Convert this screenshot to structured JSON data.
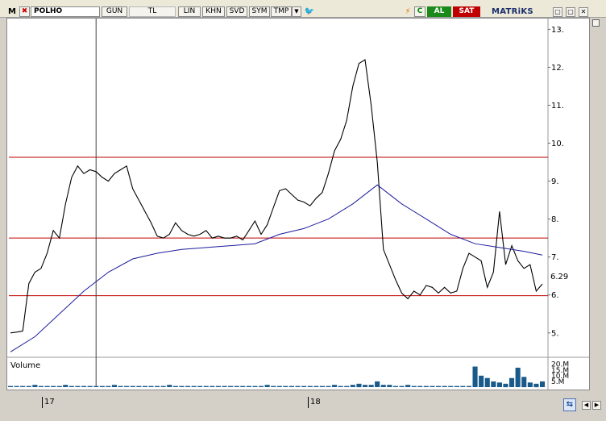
{
  "toolbar": {
    "logo": "M",
    "close": "✖",
    "symbol": "POLHO",
    "buttons": [
      "GUN",
      "TL",
      "LIN",
      "KHN",
      "SVD",
      "SYM",
      "TMP"
    ],
    "dropdown": "▼",
    "twitter": "🐦",
    "bolt": "⚡",
    "refresh": "C",
    "buy_label": "AL",
    "sell_label": "SAT",
    "brand": "MATRiKS",
    "win_controls": [
      "▢",
      "▢",
      "✕"
    ]
  },
  "colors": {
    "price_line": "#000000",
    "ma_line": "#1c1c9c",
    "h_line": "#c00000",
    "cursor_line": "#404040",
    "volume": "#1a5a8a",
    "buy": "#1a8a1a",
    "sell": "#c00000"
  },
  "chart_data": [
    {
      "type": "line",
      "y_ticks": [
        "13.",
        "12.",
        "11.",
        "10.",
        "9.",
        "8.",
        "7.",
        "6.",
        "5."
      ],
      "y_values": [
        13,
        12,
        11,
        10,
        9,
        8,
        7,
        6,
        5
      ],
      "ylim": [
        4.4,
        13.2
      ],
      "last_price_label": "6.29",
      "last_price": 6.29,
      "x_labels": [
        "17",
        "18"
      ],
      "horizontal_levels": [
        9.63,
        7.5,
        5.98
      ],
      "series": [
        {
          "points": [
            [
              0,
              5.0
            ],
            [
              1,
              5.02
            ],
            [
              2,
              5.05
            ],
            [
              3,
              6.3
            ],
            [
              4,
              6.6
            ],
            [
              5,
              6.7
            ],
            [
              6,
              7.1
            ],
            [
              7,
              7.7
            ],
            [
              8,
              7.5
            ],
            [
              9,
              8.4
            ],
            [
              10,
              9.1
            ],
            [
              11,
              9.4
            ],
            [
              12,
              9.2
            ],
            [
              13,
              9.3
            ],
            [
              14,
              9.25
            ],
            [
              15,
              9.1
            ],
            [
              16,
              9.0
            ],
            [
              17,
              9.2
            ],
            [
              18,
              9.3
            ],
            [
              19,
              9.4
            ],
            [
              20,
              8.8
            ],
            [
              21,
              8.5
            ],
            [
              22,
              8.2
            ],
            [
              23,
              7.9
            ],
            [
              24,
              7.55
            ],
            [
              25,
              7.5
            ],
            [
              26,
              7.6
            ],
            [
              27,
              7.9
            ],
            [
              28,
              7.7
            ],
            [
              29,
              7.6
            ],
            [
              30,
              7.55
            ],
            [
              31,
              7.6
            ],
            [
              32,
              7.7
            ],
            [
              33,
              7.5
            ],
            [
              34,
              7.55
            ],
            [
              35,
              7.5
            ],
            [
              36,
              7.5
            ],
            [
              37,
              7.55
            ],
            [
              38,
              7.45
            ],
            [
              39,
              7.7
            ],
            [
              40,
              7.95
            ],
            [
              41,
              7.6
            ],
            [
              42,
              7.85
            ],
            [
              43,
              8.3
            ],
            [
              44,
              8.75
            ],
            [
              45,
              8.8
            ],
            [
              46,
              8.65
            ],
            [
              47,
              8.5
            ],
            [
              48,
              8.45
            ],
            [
              49,
              8.35
            ],
            [
              50,
              8.55
            ],
            [
              51,
              8.7
            ],
            [
              52,
              9.2
            ],
            [
              53,
              9.8
            ],
            [
              54,
              10.1
            ],
            [
              55,
              10.6
            ],
            [
              56,
              11.5
            ],
            [
              57,
              12.1
            ],
            [
              58,
              12.2
            ],
            [
              59,
              11.0
            ],
            [
              60,
              9.5
            ],
            [
              61,
              7.2
            ],
            [
              62,
              6.8
            ],
            [
              63,
              6.4
            ],
            [
              64,
              6.05
            ],
            [
              65,
              5.9
            ],
            [
              66,
              6.1
            ],
            [
              67,
              6.0
            ],
            [
              68,
              6.25
            ],
            [
              69,
              6.2
            ],
            [
              70,
              6.05
            ],
            [
              71,
              6.2
            ],
            [
              72,
              6.05
            ],
            [
              73,
              6.1
            ],
            [
              74,
              6.7
            ],
            [
              75,
              7.1
            ],
            [
              76,
              7.0
            ],
            [
              77,
              6.9
            ],
            [
              78,
              6.2
            ],
            [
              79,
              6.6
            ],
            [
              80,
              8.2
            ],
            [
              81,
              6.8
            ],
            [
              82,
              7.3
            ],
            [
              83,
              6.9
            ],
            [
              84,
              6.7
            ],
            [
              85,
              6.8
            ],
            [
              86,
              6.1
            ],
            [
              87,
              6.29
            ]
          ]
        },
        {
          "points": [
            [
              0,
              4.5
            ],
            [
              4,
              4.9
            ],
            [
              8,
              5.5
            ],
            [
              12,
              6.1
            ],
            [
              16,
              6.6
            ],
            [
              20,
              6.95
            ],
            [
              24,
              7.1
            ],
            [
              28,
              7.2
            ],
            [
              32,
              7.25
            ],
            [
              36,
              7.3
            ],
            [
              40,
              7.35
            ],
            [
              44,
              7.6
            ],
            [
              48,
              7.75
            ],
            [
              52,
              8.0
            ],
            [
              56,
              8.4
            ],
            [
              60,
              8.9
            ],
            [
              64,
              8.4
            ],
            [
              68,
              8.0
            ],
            [
              72,
              7.6
            ],
            [
              76,
              7.35
            ],
            [
              80,
              7.25
            ],
            [
              84,
              7.15
            ],
            [
              87,
              7.05
            ]
          ]
        }
      ]
    },
    {
      "type": "bar",
      "title": "Volume",
      "y_ticks": [
        "20.M",
        "15.M",
        "10.M",
        "5.M"
      ],
      "y_values": [
        20,
        15,
        10,
        5
      ],
      "ylim": [
        0,
        24
      ],
      "values": [
        1,
        1,
        1,
        1,
        2,
        1,
        1,
        1,
        1,
        2,
        1,
        1,
        1,
        1,
        1,
        1,
        1,
        2,
        1,
        1,
        1,
        1,
        1,
        1,
        1,
        1,
        2,
        1,
        1,
        1,
        1,
        1,
        1,
        1,
        1,
        1,
        1,
        1,
        1,
        1,
        1,
        1,
        2,
        1,
        1,
        1,
        1,
        1,
        1,
        1,
        1,
        1,
        1,
        2,
        1,
        1,
        2,
        3,
        2,
        2,
        5,
        2,
        2,
        1,
        1,
        2,
        1,
        1,
        1,
        1,
        1,
        1,
        1,
        1,
        1,
        1,
        18,
        10,
        8,
        5,
        4,
        3,
        8,
        17,
        9,
        4,
        3,
        5
      ]
    }
  ],
  "cursor_x_index": 14
}
